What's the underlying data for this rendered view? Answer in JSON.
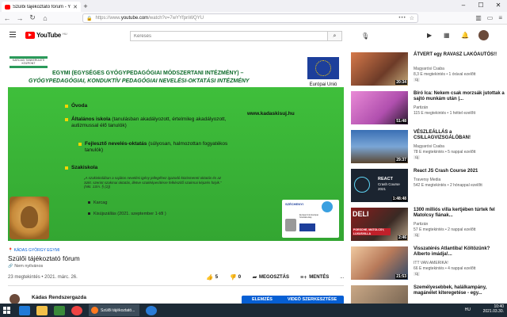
{
  "browser": {
    "tab_title": "Szülői tájékoztató fórum - Y",
    "url_prefix": "https://www.",
    "url_domain": "youtube.com",
    "url_path": "/watch?v=7wYYfpnWQYU"
  },
  "youtube": {
    "logo_text": "YouTube",
    "logo_country": "HU",
    "search_placeholder": "Keresés"
  },
  "slide": {
    "school_logo": "KARCAGI TANKERÜLETI KÖZPONT",
    "line1": "EGYMI (EGYSÉGES GYÓGYPEDAGÓGIAI MÓDSZERTANI INTÉZMÉNY) –",
    "line2": "GYÓGYPEDAGÓGIAI, KONDUKTÍV PEDAGÓGIAI NEVELÉSI-OKTATÁSI INTÉZMÉNY",
    "eu_label": "Európai Unió",
    "website": "www.kadaskisuj.hu",
    "bullet_ovoda": "Óvoda",
    "bullet_altalanos_b": "Általános iskola",
    "bullet_altalanos_r": " (tanulásban akadályozott, értelmileg akadályozott, autizmussal élő tanulók)",
    "bullet_fejleszto_b": "Fejlesztő nevelés-oktatás",
    "bullet_fejleszto_r": " (súlyosan, halmozottan fogyatékos tanulók)",
    "bullet_szakiskola": "Szakiskola",
    "small_text": "„A szakiskolában a sajátos nevelési igény jellegéhez igazodó közismereti oktatás és az Szkt. szerint szakmai oktatás, illetve szakképesítésre felkészítő szakmai képzés folyik.” (Nkt. 13/A. § (2))",
    "sub1": "Karcag",
    "sub2": "Kisújszállás  (2021. szeptember 1-től )",
    "szechenyi": "SZÉCHENYI",
    "szechenyi_small": "Európai Unió Európai Szociális Alap"
  },
  "video": {
    "channel_tag": "KÁDAS GYÖRGY EGYMI",
    "title": "Szülői tájékoztató fórum",
    "listed": "Nem nyilvános",
    "views": "23 megtekintés • 2021. márc. 26.",
    "likes": "5",
    "dislikes": "0",
    "share": "MEGOSZTÁS",
    "save": "MENTÉS",
    "more": "...",
    "owner": "Kádas Rendszergazda",
    "btn_edit": "ELEMZÉS",
    "btn_video_edit": "VIDEÓ SZERKESZTÉSE"
  },
  "recs": [
    {
      "title": "ÁTVERT egy RAVASZ LAKÓAUTÓS!!",
      "channel": "Magyarósi Csaba",
      "meta": "8,3 E megtekintés • 1 órával ezelőtt",
      "badge": "Új",
      "duration": "20:34"
    },
    {
      "title": "Bíró Ica: Nekem csak morzsák jutottak a sajtó munkám után |...",
      "channel": "Partizán",
      "meta": "115 E megtekintés • 1 héttel ezelőtt",
      "badge": "",
      "duration": "51:48"
    },
    {
      "title": "VÉSZLEÁLLÁS a CSILLAGVIZSGÁLÓBAN!",
      "channel": "Magyarósi Csaba",
      "meta": "78 E megtekintés • 5 nappal ezelőtt",
      "badge": "Új",
      "duration": "29:37"
    },
    {
      "title": "React JS Crash Course 2021",
      "channel": "Traversy Media",
      "meta": "542 E megtekintés • 2 hónappal ezelőtt",
      "badge": "",
      "duration": "1:48:48"
    },
    {
      "title": "1300 milliós villa kertjében túrtek fel Matolcsy fiának...",
      "channel": "Partizán",
      "meta": "57 E megtekintés • 2 nappal ezelőtt",
      "badge": "Új",
      "duration": "2:46"
    },
    {
      "title": "Visszatérés Atlantiba! Költözünk? Alberto imádja!...",
      "channel": "ITT VAN AMERIKA!",
      "meta": "66 E megtekintés • 4 nappal ezelőtt",
      "badge": "Új",
      "duration": "21:53"
    },
    {
      "title": "Személyesebbek, halálkampány, magánélet kiteregetése - egy...",
      "channel": "",
      "meta": "",
      "badge": "",
      "duration": ""
    }
  ],
  "rec_thumb_labels": {
    "react": "REACT",
    "crash": "Crash Course",
    "year": "2021",
    "deli": "DELI",
    "porsche": "PORSCHE, MATOLCSY, LUXUSVILLA"
  },
  "taskbar": {
    "task_label": "Szülői tájékoztató...",
    "lang": "HU",
    "time": "10:40",
    "date": "2021.03.30."
  }
}
